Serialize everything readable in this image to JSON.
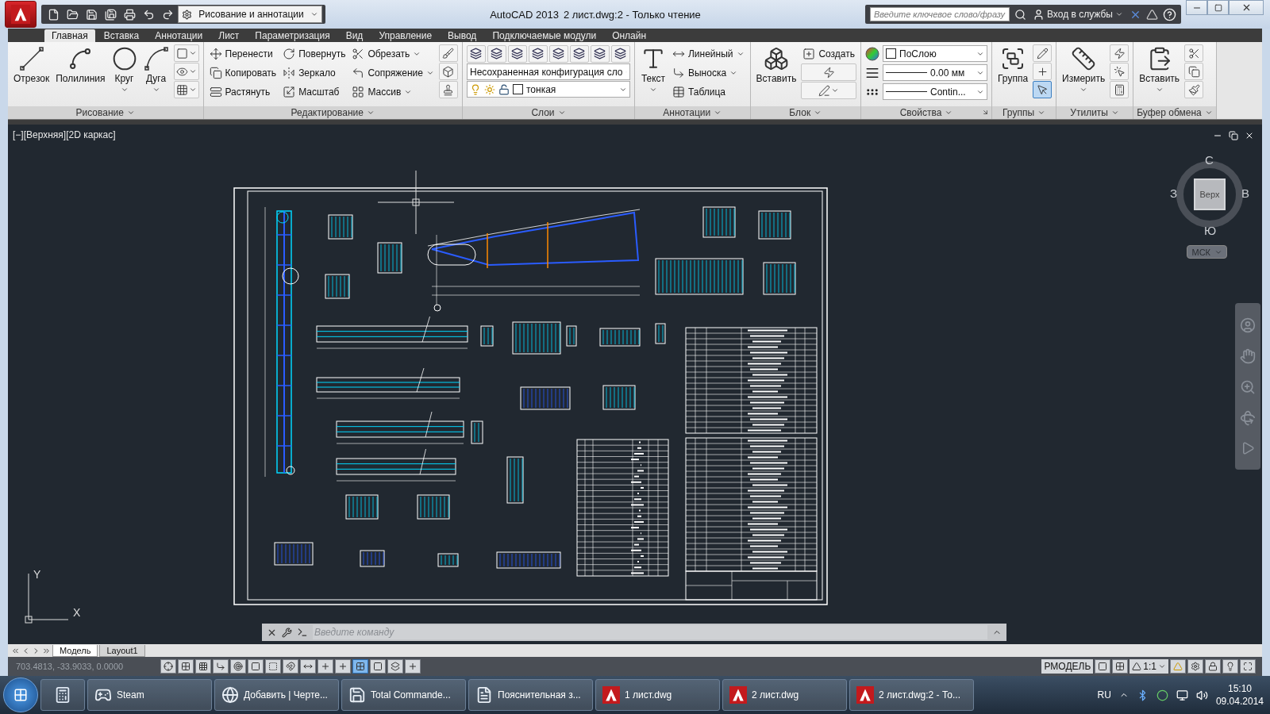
{
  "title_bar": {
    "workspace": "Рисование и аннотации",
    "app_name": "AutoCAD 2013",
    "document": "2 лист.dwg:2 - Только чтение",
    "search": {
      "placeholder": "Введите ключевое слово/фразу"
    },
    "sign_in": "Вход в службы"
  },
  "ribbon_tabs": [
    {
      "label": "Главная",
      "selected": true
    },
    {
      "label": "Вставка",
      "selected": false
    },
    {
      "label": "Аннотации",
      "selected": false
    },
    {
      "label": "Лист",
      "selected": false
    },
    {
      "label": "Параметризация",
      "selected": false
    },
    {
      "label": "Вид",
      "selected": false
    },
    {
      "label": "Управление",
      "selected": false
    },
    {
      "label": "Вывод",
      "selected": false
    },
    {
      "label": "Подключаемые модули",
      "selected": false
    },
    {
      "label": "Онлайн",
      "selected": false
    }
  ],
  "ribbon_panels": [
    {
      "title": "Рисование",
      "launcher": false,
      "columns": [
        [
          {
            "kind": "large",
            "label": "Отрезок"
          }
        ],
        [
          {
            "kind": "large",
            "label": "Полилиния"
          }
        ],
        [
          {
            "kind": "large_menu",
            "label": "Круг"
          }
        ],
        [
          {
            "kind": "large_menu",
            "label": "Дуга"
          }
        ],
        [
          {
            "kind": "icon_menu"
          },
          {
            "kind": "icon_menu"
          },
          {
            "kind": "icon_menu"
          }
        ]
      ]
    },
    {
      "title": "Редактирование",
      "launcher": false,
      "columns": [
        [
          {
            "kind": "small",
            "label": "Перенести"
          },
          {
            "kind": "small",
            "label": "Копировать"
          },
          {
            "kind": "small",
            "label": "Растянуть"
          }
        ],
        [
          {
            "kind": "small",
            "label": "Повернуть"
          },
          {
            "kind": "small",
            "label": "Зеркало"
          },
          {
            "kind": "small",
            "label": "Масштаб"
          }
        ],
        [
          {
            "kind": "small_menu",
            "label": "Обрезать"
          },
          {
            "kind": "small_menu",
            "label": "Сопряжение"
          },
          {
            "kind": "small_menu",
            "label": "Массив"
          }
        ],
        [
          {
            "kind": "icon"
          },
          {
            "kind": "icon"
          },
          {
            "kind": "icon"
          }
        ]
      ]
    },
    {
      "title": "Слои",
      "launcher": false,
      "columns": [
        [
          {
            "kind": "toolbar"
          },
          {
            "kind": "combo",
            "value": "Несохраненная конфигурация сло"
          },
          {
            "kind": "layer_combo",
            "value": "тонкая"
          }
        ]
      ]
    },
    {
      "title": "Аннотации",
      "launcher": false,
      "columns": [
        [
          {
            "kind": "large_menu",
            "label": "Текст"
          }
        ],
        [
          {
            "kind": "small_menu",
            "label": "Линейный"
          },
          {
            "kind": "small_menu",
            "label": "Выноска"
          },
          {
            "kind": "small",
            "label": "Таблица"
          }
        ]
      ]
    },
    {
      "title": "Блок",
      "launcher": false,
      "columns": [
        [
          {
            "kind": "large",
            "label": "Вставить"
          }
        ],
        [
          {
            "kind": "small",
            "label": "Создать"
          },
          {
            "kind": "icon"
          },
          {
            "kind": "icon_menu"
          }
        ]
      ]
    },
    {
      "title": "Свойства",
      "launcher": true,
      "columns": [
        [
          {
            "kind": "color_combo",
            "value": "ПоСлою"
          },
          {
            "kind": "weight_combo",
            "value": "0.00 мм"
          },
          {
            "kind": "type_combo",
            "value": "Contin..."
          }
        ]
      ]
    },
    {
      "title": "Группы",
      "launcher": false,
      "columns": [
        [
          {
            "kind": "large",
            "label": "Группа"
          }
        ],
        [
          {
            "kind": "icon",
            "on": false
          },
          {
            "kind": "icon",
            "on": false
          },
          {
            "kind": "icon",
            "on": true
          }
        ]
      ]
    },
    {
      "title": "Утилиты",
      "launcher": false,
      "columns": [
        [
          {
            "kind": "large_menu",
            "label": "Измерить"
          }
        ],
        [
          {
            "kind": "icon"
          },
          {
            "kind": "icon"
          },
          {
            "kind": "icon"
          }
        ]
      ]
    },
    {
      "title": "Буфер обмена",
      "launcher": false,
      "columns": [
        [
          {
            "kind": "large_menu",
            "label": "Вставить"
          }
        ],
        [
          {
            "kind": "icon"
          },
          {
            "kind": "icon"
          },
          {
            "kind": "icon"
          }
        ]
      ]
    }
  ],
  "viewport": {
    "label": "[−][Верхняя][2D каркас]",
    "viewcube": {
      "north": "С",
      "west": "З",
      "east": "В",
      "south": "Ю",
      "face": "Верх",
      "ucs_menu": "МСК"
    },
    "ucs_icon": {
      "y": "Y",
      "x": "X"
    }
  },
  "command_line": {
    "placeholder": "Введите команду"
  },
  "layout_tabs": [
    {
      "label": "Модель",
      "selected": true
    },
    {
      "label": "Layout1",
      "selected": false
    }
  ],
  "status_bar": {
    "coordinates": "703.4813, -33.9033, 0.0000",
    "toggles": [
      {
        "on": false
      },
      {
        "on": false
      },
      {
        "on": false
      },
      {
        "on": false
      },
      {
        "on": false
      },
      {
        "on": false
      },
      {
        "on": false
      },
      {
        "on": false
      },
      {
        "on": false
      },
      {
        "on": false
      },
      {
        "on": false
      },
      {
        "on": true
      },
      {
        "on": false
      },
      {
        "on": false
      },
      {
        "on": false
      }
    ],
    "model": "РМОДЕЛЬ",
    "scale": "1:1"
  },
  "taskbar": {
    "apps": [
      {
        "label": "Steam"
      },
      {
        "label": "Добавить | Черте..."
      },
      {
        "label": "Total Commande..."
      },
      {
        "label": "Пояснительная з..."
      },
      {
        "label": "1 лист.dwg"
      },
      {
        "label": "2 лист.dwg"
      },
      {
        "label": "2 лист.dwg:2 - То..."
      }
    ],
    "language": "RU",
    "time": "15:10",
    "date": "09.04.2014"
  }
}
